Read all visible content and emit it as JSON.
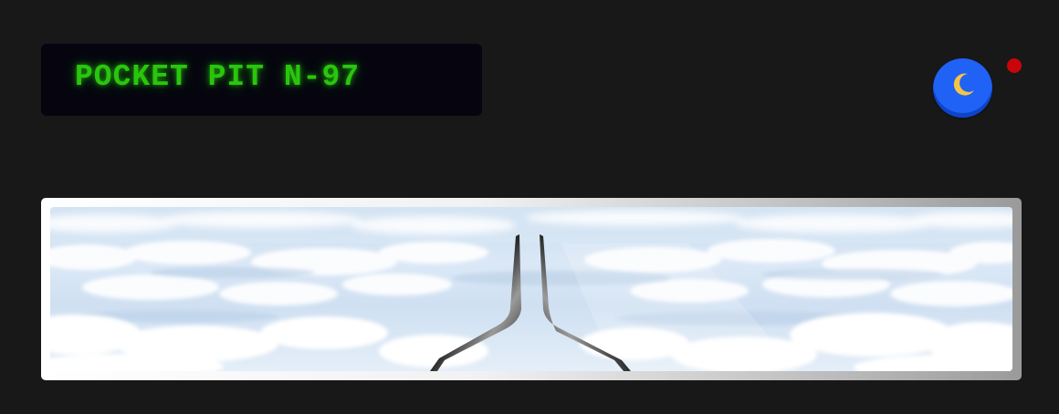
{
  "header": {
    "title": "POCKET PIT N-97"
  },
  "controls": {
    "theme_toggle_icon": "moon-icon",
    "status_indicator_color": "#c8050a"
  },
  "colors": {
    "background": "#181818",
    "title_text": "#29c60d",
    "toggle": "#1f62f5",
    "moon": "#f4c542"
  }
}
